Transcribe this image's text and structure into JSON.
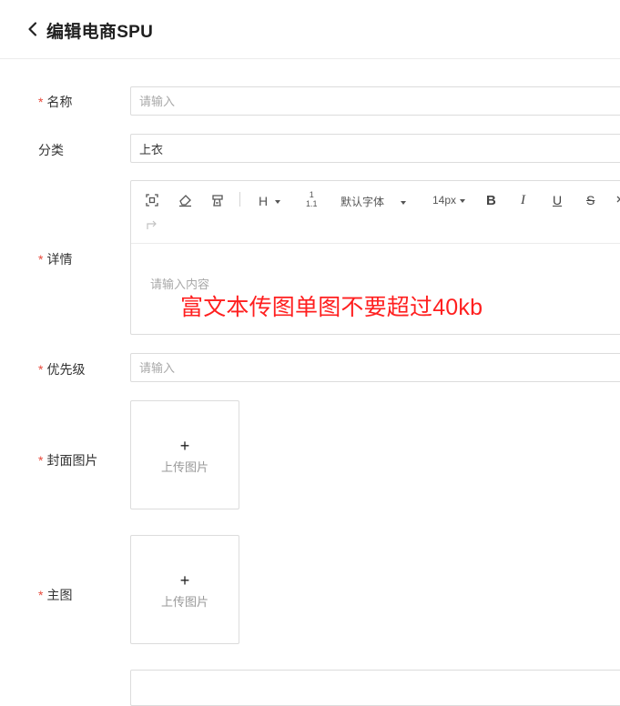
{
  "header": {
    "title": "编辑电商SPU"
  },
  "form": {
    "required_mark": "*",
    "name": {
      "label": "名称",
      "placeholder": "请输入"
    },
    "category": {
      "label": "分类",
      "value": "上衣"
    },
    "details": {
      "label": "详情",
      "placeholder": "请输入内容",
      "toolbar": {
        "heading": "H",
        "list_top": "1",
        "list_bottom": "1.1",
        "font_family": "默认字体",
        "font_size": "14px",
        "bold": "B",
        "italic": "I",
        "underline": "U",
        "strikethrough": "S"
      }
    },
    "priority": {
      "label": "优先级",
      "placeholder": "请输入"
    },
    "cover_image": {
      "label": "封面图片",
      "plus": "+",
      "upload_text": "上传图片"
    },
    "main_image": {
      "label": "主图",
      "plus": "+",
      "upload_text": "上传图片"
    }
  },
  "notice": "富文本传图单图不要超过40kb"
}
